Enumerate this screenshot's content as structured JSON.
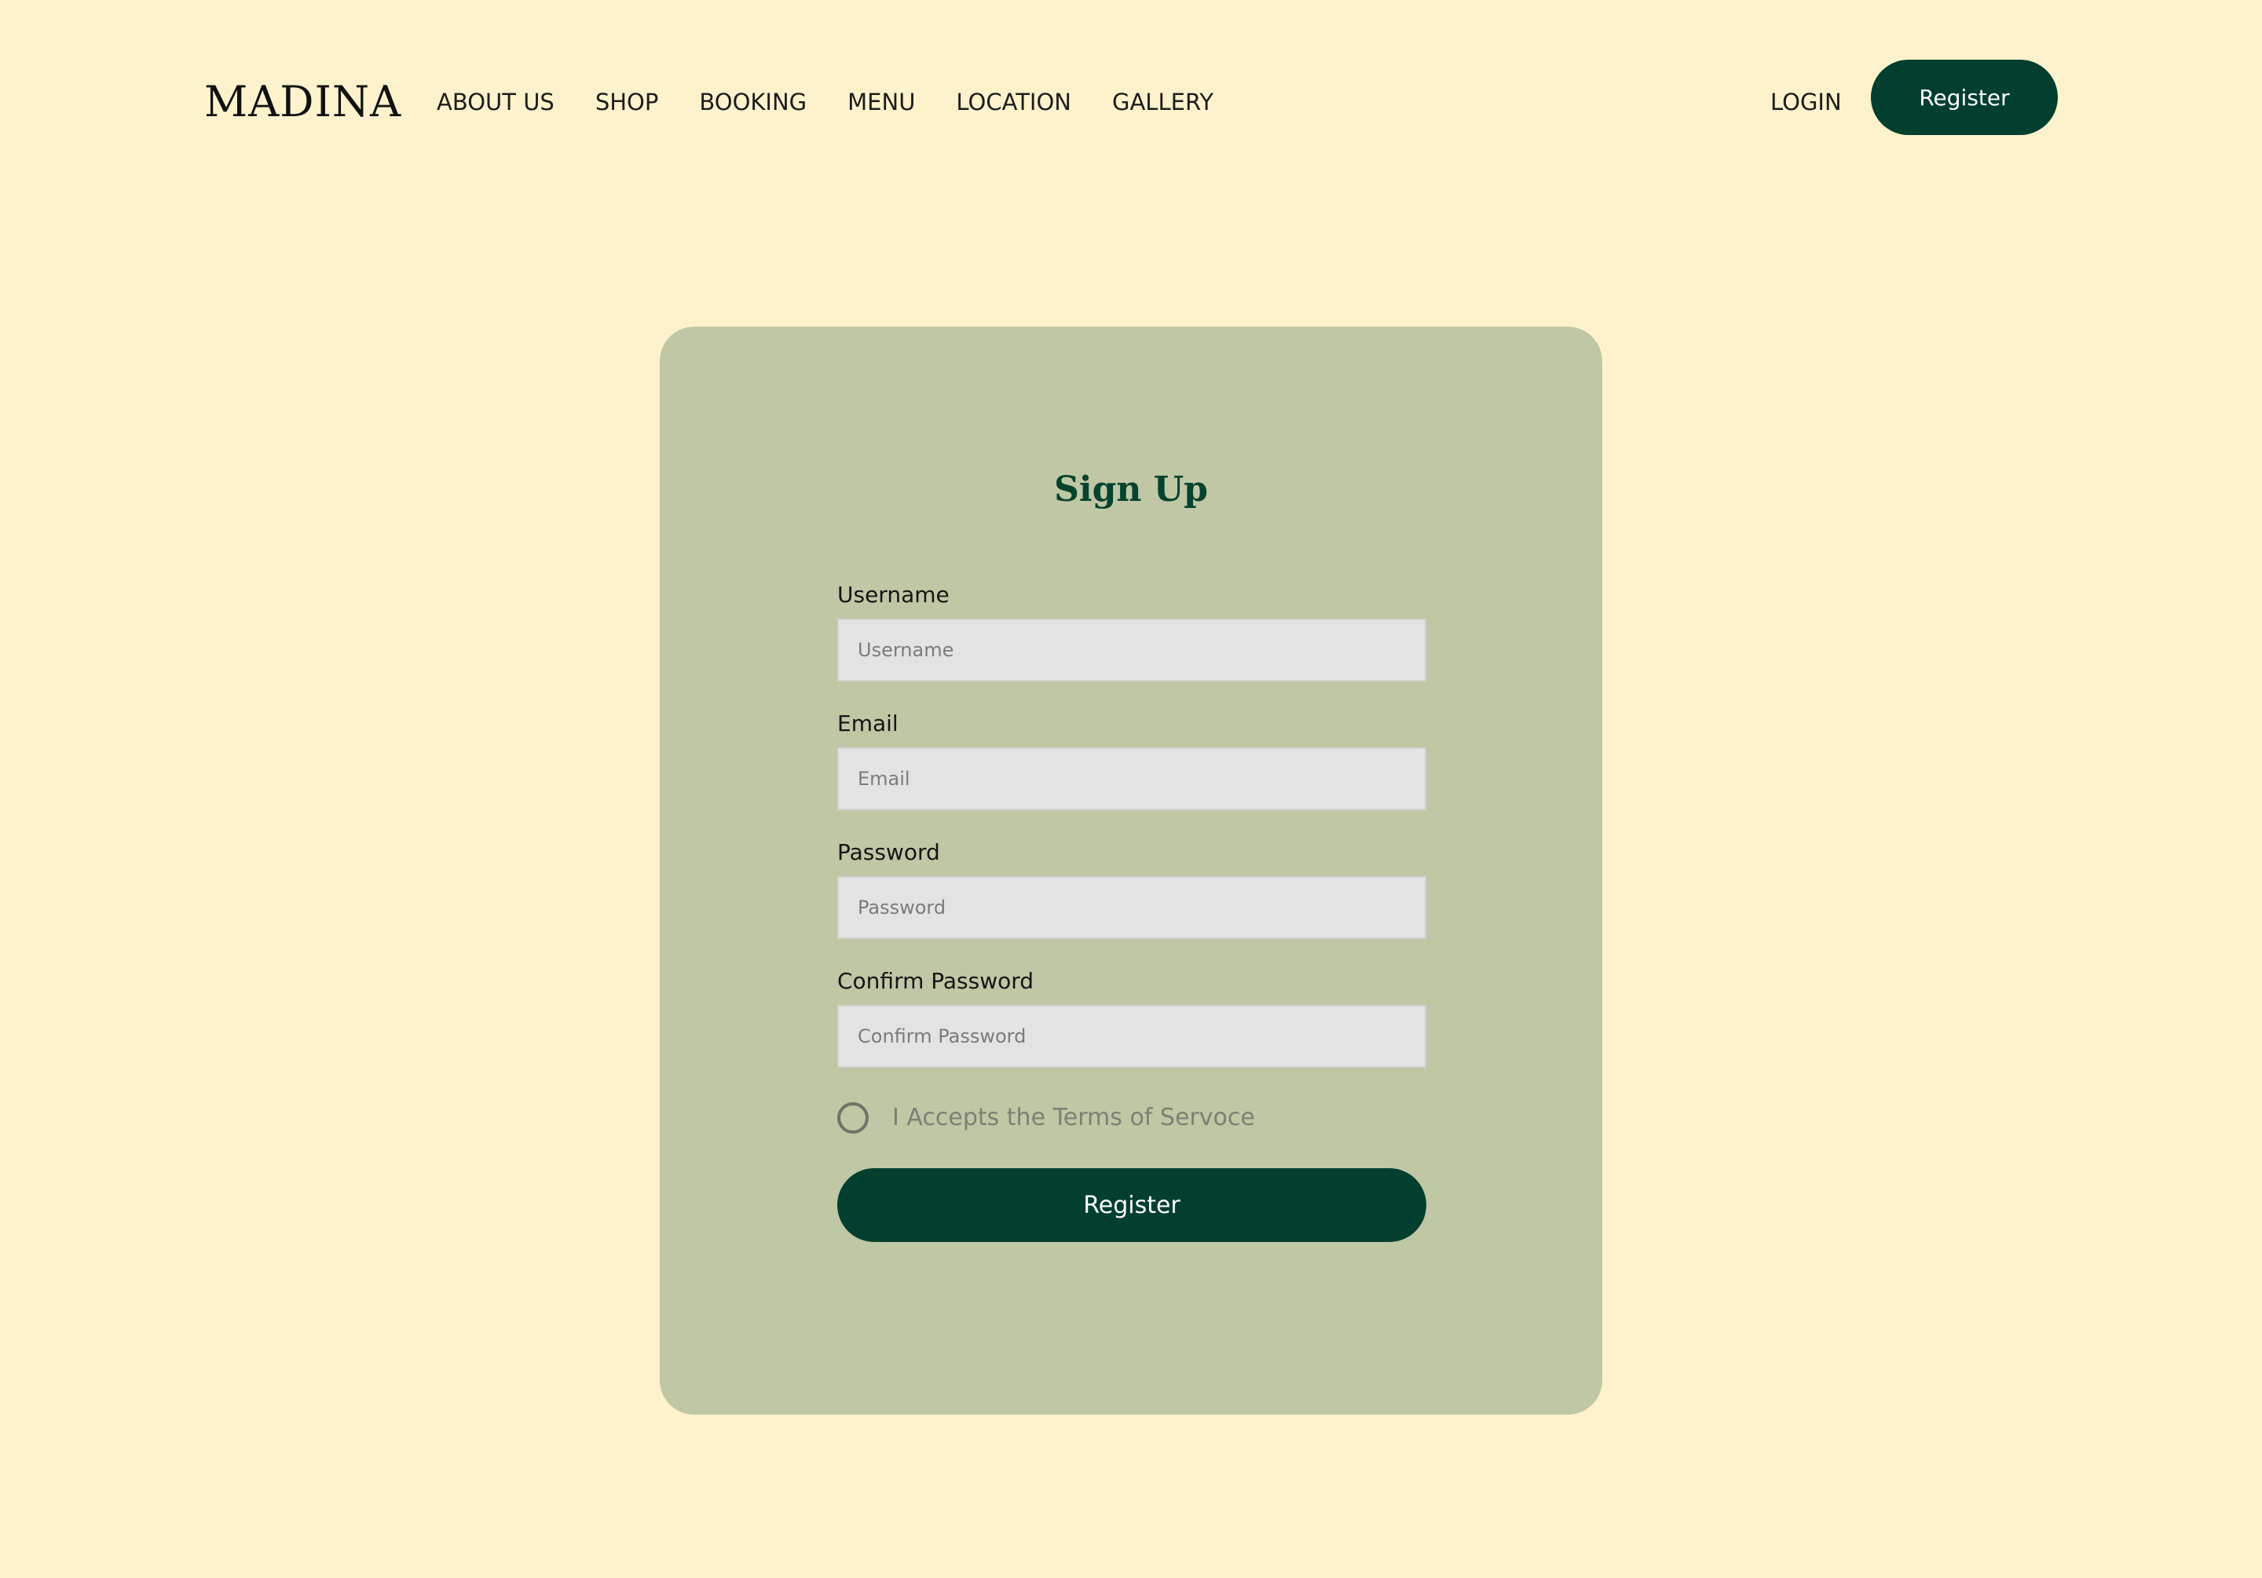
{
  "brand": {
    "logo": "MADINA"
  },
  "nav": {
    "items": [
      {
        "label": "ABOUT US"
      },
      {
        "label": "SHOP"
      },
      {
        "label": "BOOKING"
      },
      {
        "label": "MENU"
      },
      {
        "label": "LOCATION"
      },
      {
        "label": "GALLERY"
      }
    ],
    "login_label": "LOGIN",
    "register_label": "Register"
  },
  "form": {
    "title": "Sign Up",
    "fields": {
      "username": {
        "label": "Username",
        "placeholder": "Username",
        "value": ""
      },
      "email": {
        "label": "Email",
        "placeholder": "Email",
        "value": ""
      },
      "password": {
        "label": "Password",
        "placeholder": "Password",
        "value": ""
      },
      "confirm_password": {
        "label": "Confirm Password",
        "placeholder": "Confirm Password",
        "value": ""
      }
    },
    "terms_label": "I Accepts the Terms of Servoce",
    "terms_checked": false,
    "submit_label": "Register"
  },
  "colors": {
    "background": "#FEF2CC",
    "card": "#BFC7A4",
    "accent": "#033F2F",
    "input_bg": "#E3E3E3",
    "title": "#06432F"
  },
  "icons": {
    "terms_toggle": "radio-circle-icon"
  }
}
